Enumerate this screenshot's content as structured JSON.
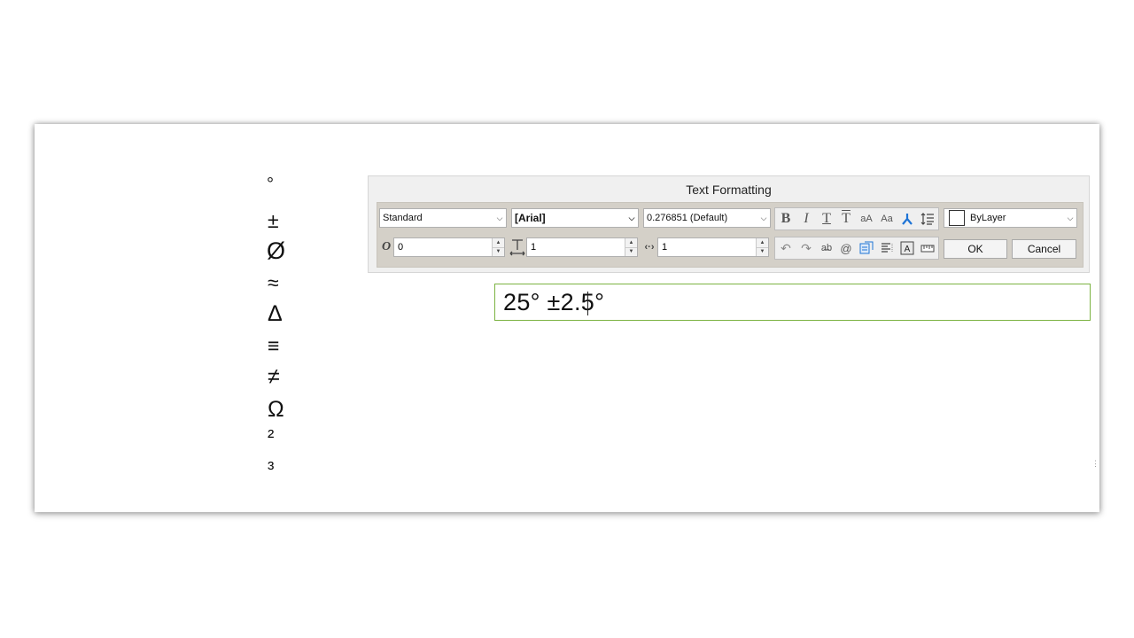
{
  "symbols": [
    "°",
    "±",
    "Ø",
    "≈",
    "Δ",
    "≡",
    "≠",
    "Ω",
    "²",
    "³"
  ],
  "dialog": {
    "title": "Text Formatting",
    "style_value": "Standard",
    "font_value": "[Arial]",
    "height_value": "0.276851 (Default)",
    "color_value": "ByLayer",
    "oblique_value": "0",
    "tracking_value": "1",
    "width_value": "1",
    "ok_label": "OK",
    "cancel_label": "Cancel",
    "format_icons": [
      "bold-icon",
      "italic-icon",
      "underline-icon",
      "overline-icon",
      "uppercase-icon",
      "lowercase-icon",
      "symbol-stack-icon",
      "line-spacing-icon"
    ],
    "edit_icons": [
      "undo-icon",
      "redo-icon",
      "strikethrough-icon",
      "at-symbol-icon",
      "field-icon",
      "paragraph-icon",
      "background-mask-icon",
      "ruler-icon"
    ]
  },
  "editor": {
    "text": "25° ±2.5°"
  },
  "colors": {
    "editor_border": "#7cb342",
    "toolbar_bg": "#d4d0c8",
    "panel_bg": "#f0f0f0",
    "accent_blue": "#1e74d6"
  }
}
